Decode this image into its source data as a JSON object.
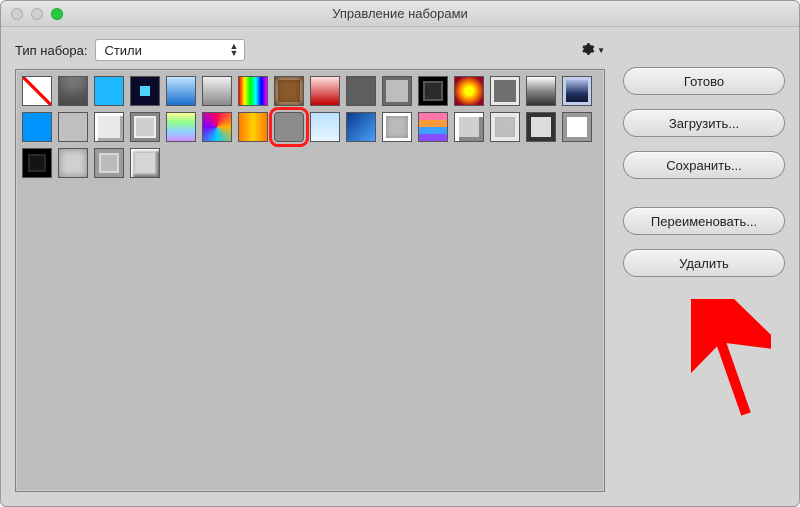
{
  "window": {
    "title": "Управление наборами"
  },
  "typerow": {
    "label": "Тип набора:",
    "select_value": "Стили"
  },
  "buttons": {
    "done": "Готово",
    "load": "Загрузить...",
    "save": "Сохранить...",
    "rename": "Переименовать...",
    "delete": "Удалить"
  },
  "swatches": {
    "selected_index": 23,
    "items": [
      "s-none",
      "s-flatgray",
      "s-cyan",
      "s-darksq",
      "s-bluegrad",
      "s-graygrad",
      "s-rainbow",
      "s-brownbev",
      "s-redgrad",
      "s-dgray",
      "s-outline",
      "s-darkbev",
      "s-firetile",
      "s-biggray",
      "s-chrome1",
      "s-chrome2",
      "s-cyan2",
      "s-ltgray",
      "s-whitetile",
      "s-tile2",
      "s-rainbow2",
      "s-abstract",
      "s-orange",
      "s-midgray",
      "s-cloud",
      "s-bluediag",
      "s-bevelc",
      "s-stripes",
      "s-emboss1",
      "s-emboss2",
      "s-darkin",
      "s-framewh",
      "s-blbev",
      "s-softg",
      "s-inner",
      "s-button"
    ]
  },
  "annotation": {
    "arrow_points_to": "delete-button"
  }
}
